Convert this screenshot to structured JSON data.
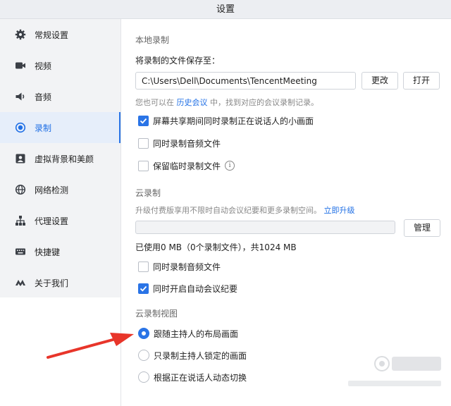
{
  "window": {
    "title": "设置"
  },
  "sidebar": {
    "items": [
      {
        "label": "常规设置",
        "icon": "gear-icon"
      },
      {
        "label": "视频",
        "icon": "video-camera-icon"
      },
      {
        "label": "音频",
        "icon": "speaker-icon"
      },
      {
        "label": "录制",
        "icon": "record-icon",
        "active": true
      },
      {
        "label": "虚拟背景和美颜",
        "icon": "portrait-icon"
      },
      {
        "label": "网络检测",
        "icon": "globe-icon"
      },
      {
        "label": "代理设置",
        "icon": "network-tree-icon"
      },
      {
        "label": "快捷键",
        "icon": "keyboard-icon"
      },
      {
        "label": "关于我们",
        "icon": "tencent-logo-icon"
      }
    ]
  },
  "local": {
    "section_title": "本地录制",
    "save_to_label": "将录制的文件保存至：",
    "path_value": "C:\\Users\\Dell\\Documents\\TencentMeeting",
    "change_button": "更改",
    "open_button": "打开",
    "hint_prefix": "您也可以在",
    "hint_link": "历史会议",
    "hint_suffix": "中，找到对应的会议录制记录。",
    "options": [
      {
        "label": "屏幕共享期间同时录制正在说话人的小画面",
        "checked": true
      },
      {
        "label": "同时录制音频文件",
        "checked": false
      },
      {
        "label": "保留临时录制文件",
        "checked": false
      }
    ]
  },
  "cloud": {
    "section_title": "云录制",
    "upgrade_hint": "升级付费版享用不限时自动会议纪要和更多录制空间。",
    "upgrade_link": "立即升级",
    "manage_button": "管理",
    "usage_text": "已使用0 MB（0个录制文件），共1024 MB",
    "usage_fraction": 0,
    "options": [
      {
        "label": "同时录制音频文件",
        "checked": false
      },
      {
        "label": "同时开启自动会议纪要",
        "checked": true
      }
    ]
  },
  "cloud_view": {
    "section_title": "云录制视图",
    "options": [
      {
        "label": "跟随主持人的布局画面",
        "selected": true
      },
      {
        "label": "只录制主持人锁定的画面",
        "selected": false
      },
      {
        "label": "根据正在说话人动态切换",
        "selected": false
      }
    ]
  },
  "annotation": {
    "color": "#e8352a"
  },
  "colors": {
    "accent": "#2a74e6",
    "link": "#1f6fe5"
  }
}
